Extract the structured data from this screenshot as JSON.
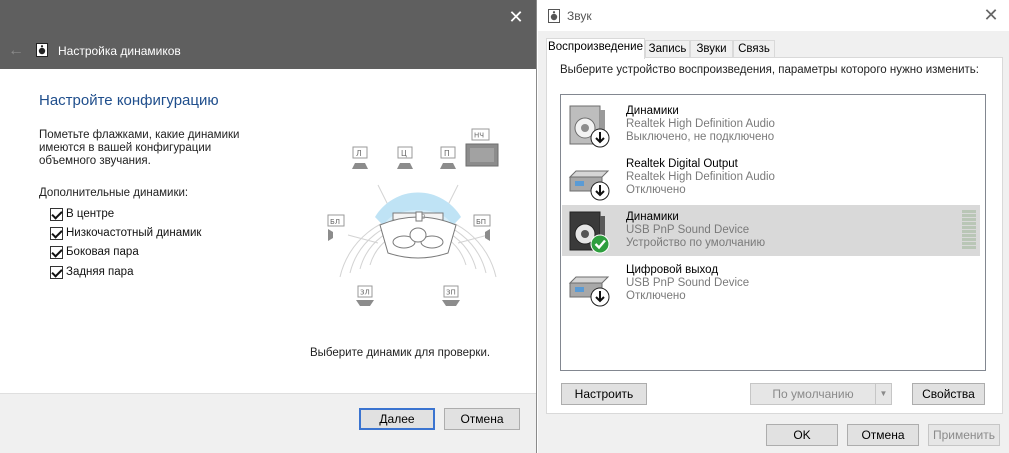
{
  "wizard": {
    "nav_title": "Настройка динамиков",
    "heading": "Настройте конфигурацию",
    "description": "Пометьте флажками, какие динамики имеются в вашей конфигурации объемного звучания.",
    "optional_label": "Дополнительные динамики:",
    "options": [
      {
        "label": "В центре",
        "checked": true
      },
      {
        "label": "Низкочастотный динамик",
        "checked": true
      },
      {
        "label": "Боковая пара",
        "checked": true
      },
      {
        "label": "Задняя пара",
        "checked": true
      }
    ],
    "speaker_labels": {
      "front_left": "Л",
      "center": "Ц",
      "front_right": "П",
      "subwoofer": "НЧ",
      "side_left": "БЛ",
      "side_right": "БП",
      "rear_left": "ЗЛ",
      "rear_right": "ЗП"
    },
    "test_hint": "Выберите динамик для проверки.",
    "next_button": "Далее",
    "cancel_button": "Отмена"
  },
  "sound": {
    "title": "Звук",
    "tabs": [
      "Воспроизведение",
      "Запись",
      "Звуки",
      "Связь"
    ],
    "active_tab": "Воспроизведение",
    "instruction": "Выберите устройство воспроизведения, параметры которого нужно изменить:",
    "devices": [
      {
        "name": "Динамики",
        "driver": "Realtek High Definition Audio",
        "status": "Выключено, не подключено",
        "icon": "speaker-icon",
        "badge": "down-arrow",
        "selected": false
      },
      {
        "name": "Realtek Digital Output",
        "driver": "Realtek High Definition Audio",
        "status": "Отключено",
        "icon": "digital-output-icon",
        "badge": "down-arrow",
        "selected": false
      },
      {
        "name": "Динамики",
        "driver": "USB PnP Sound Device",
        "status": "Устройство по умолчанию",
        "icon": "speaker-icon",
        "badge": "check",
        "selected": true
      },
      {
        "name": "Цифровой выход",
        "driver": "USB PnP Sound Device",
        "status": "Отключено",
        "icon": "digital-output-icon",
        "badge": "down-arrow",
        "selected": false
      }
    ],
    "configure_button": "Настроить",
    "default_button": "По умолчанию",
    "properties_button": "Свойства",
    "ok_button": "OK",
    "cancel_button": "Отмена",
    "apply_button": "Применить"
  },
  "colors": {
    "wizard_titlebar": "#5f5f5f",
    "heading": "#1f4e8c",
    "selected_row": "#d9d9d9",
    "check_badge": "#2e9e3e",
    "primary_border": "#3b74d0"
  }
}
